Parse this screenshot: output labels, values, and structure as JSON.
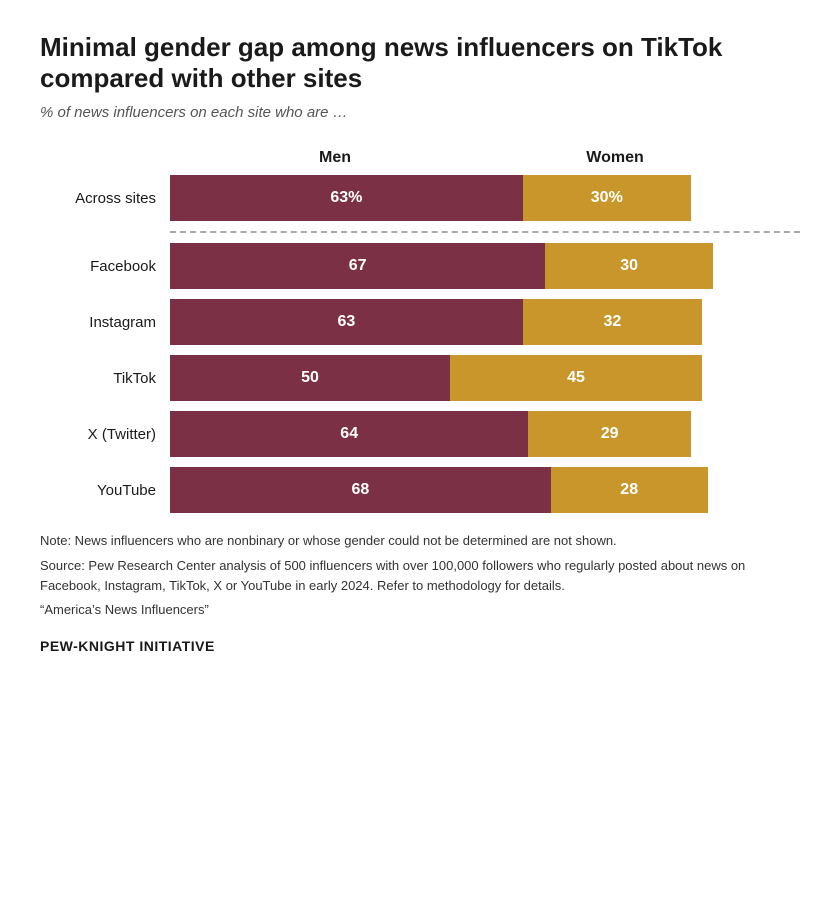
{
  "title": "Minimal gender gap among news influencers on TikTok compared with other sites",
  "subtitle": "% of news influencers on each site who are …",
  "legend": {
    "men": "Men",
    "women": "Women"
  },
  "total_width": 560,
  "rows": [
    {
      "label": "Across sites",
      "men_val": 63,
      "women_val": 30,
      "men_display": "63%",
      "women_display": "30%",
      "is_across": true
    },
    {
      "label": "Facebook",
      "men_val": 67,
      "women_val": 30,
      "men_display": "67",
      "women_display": "30",
      "is_across": false
    },
    {
      "label": "Instagram",
      "men_val": 63,
      "women_val": 32,
      "men_display": "63",
      "women_display": "32",
      "is_across": false
    },
    {
      "label": "TikTok",
      "men_val": 50,
      "women_val": 45,
      "men_display": "50",
      "women_display": "45",
      "is_across": false
    },
    {
      "label": "X (Twitter)",
      "men_val": 64,
      "women_val": 29,
      "men_display": "64",
      "women_display": "29",
      "is_across": false
    },
    {
      "label": "YouTube",
      "men_val": 68,
      "women_val": 28,
      "men_display": "68",
      "women_display": "28",
      "is_across": false
    }
  ],
  "note": "Note: News influencers who are nonbinary or whose gender could not be determined are not shown.",
  "source": "Source: Pew Research Center analysis of 500 influencers with over 100,000 followers who regularly posted about news on Facebook, Instagram, TikTok, X or YouTube in early 2024. Refer to methodology for details.",
  "quote": "“America’s News Influencers”",
  "brand": "PEW-KNIGHT INITIATIVE",
  "colors": {
    "men": "#7b3045",
    "women": "#c8962a"
  }
}
